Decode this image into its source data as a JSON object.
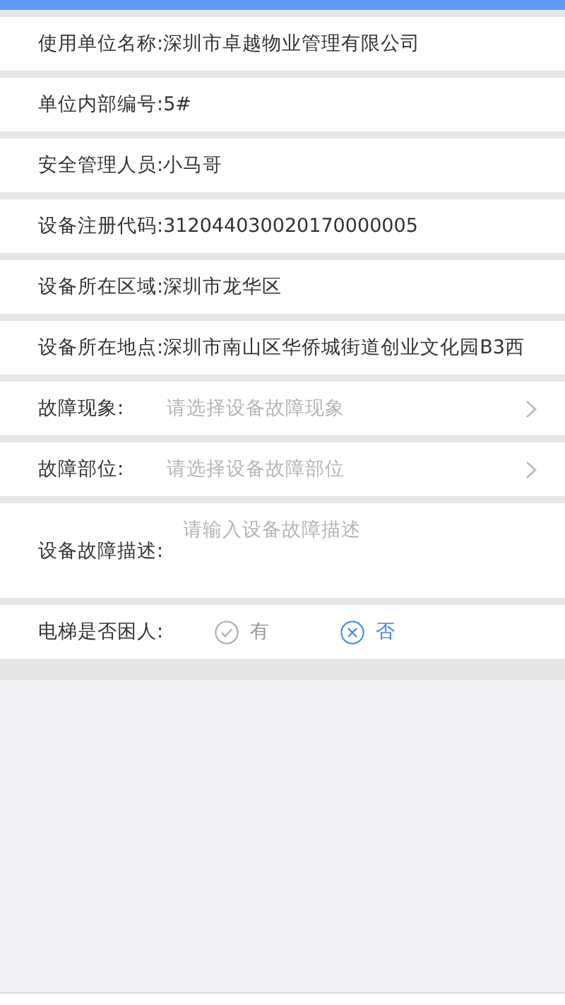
{
  "fields": [
    {
      "kind": "info",
      "label": "使用单位名称:",
      "value": "深圳市卓越物业管理有限公司"
    },
    {
      "kind": "info",
      "label": "单位内部编号:",
      "value": "5#"
    },
    {
      "kind": "info",
      "label": "安全管理人员:",
      "value": "小马哥"
    },
    {
      "kind": "info",
      "label": "设备注册代码:",
      "value": "312044030020170000005"
    },
    {
      "kind": "info",
      "label": "设备所在区域:",
      "value": "深圳市龙华区"
    },
    {
      "kind": "info",
      "label": "设备所在地点:",
      "value": "深圳市南山区华侨城街道创业文化园B3西"
    },
    {
      "kind": "select",
      "label": "故障现象:",
      "placeholder": "请选择设备故障现象"
    },
    {
      "kind": "select",
      "label": "故障部位:",
      "placeholder": "请选择设备故障部位"
    },
    {
      "kind": "textarea",
      "label": "设备故障描述:",
      "placeholder": "请输入设备故障描述"
    },
    {
      "kind": "radio",
      "label": "电梯是否困人:",
      "options": [
        {
          "label": "有",
          "selected": false
        },
        {
          "label": "否",
          "selected": true
        }
      ]
    }
  ]
}
